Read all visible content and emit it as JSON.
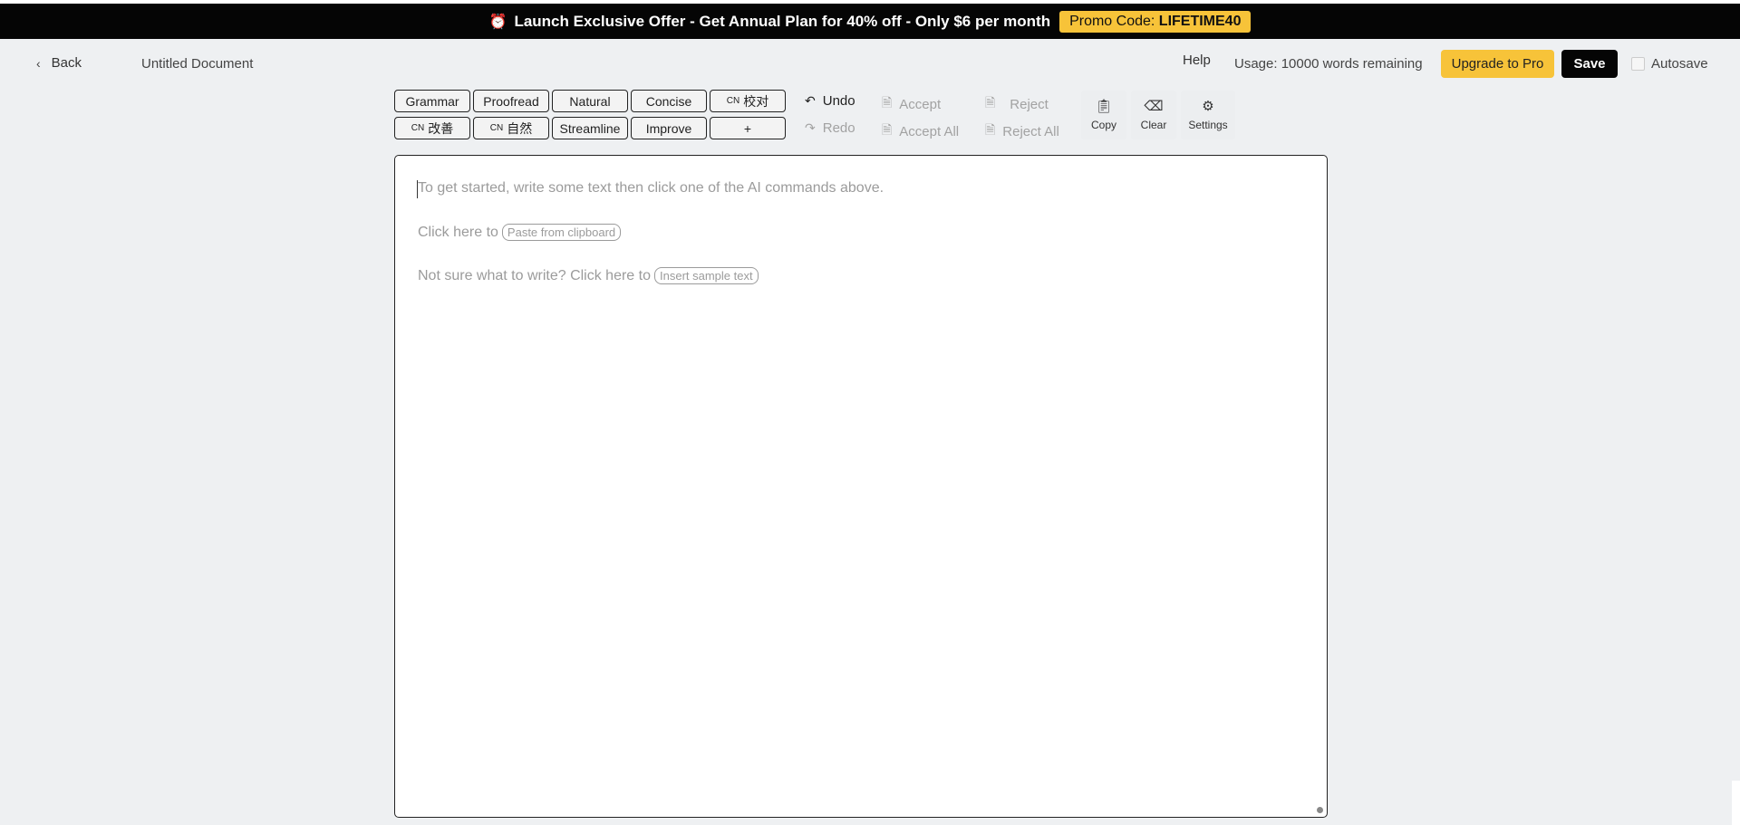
{
  "banner": {
    "icon": "alarm-clock-icon",
    "text": "Launch Exclusive Offer -   Get Annual Plan for 40% off - Only $6 per month",
    "promo_label": "Promo Code: ",
    "promo_code": "LIFETIME40"
  },
  "header": {
    "back_label": "Back",
    "doc_title": "Untitled Document",
    "help_label": "Help",
    "usage_text": "Usage: 10000 words remaining",
    "upgrade_label": "Upgrade to Pro",
    "save_label": "Save",
    "autosave_label": "Autosave"
  },
  "commands": {
    "row1": [
      {
        "label": "Grammar"
      },
      {
        "label": "Proofread"
      },
      {
        "label": "Natural"
      },
      {
        "label": "Concise"
      },
      {
        "prefix": "CN",
        "label": "校对"
      }
    ],
    "row2": [
      {
        "prefix": "CN",
        "label": "改善"
      },
      {
        "prefix": "CN",
        "label": "自然"
      },
      {
        "label": "Streamline"
      },
      {
        "label": "Improve"
      },
      {
        "label": "+"
      }
    ]
  },
  "actions": {
    "undo": "Undo",
    "redo": "Redo",
    "accept": "Accept",
    "accept_all": "Accept All",
    "reject": "Reject",
    "reject_all": "Reject All"
  },
  "tools": {
    "copy": "Copy",
    "clear": "Clear",
    "settings": "Settings"
  },
  "editor": {
    "placeholder": "To get started, write some text then click one of the AI commands above.",
    "paste_prompt": "Click here to",
    "paste_chip": "Paste from clipboard",
    "sample_prompt": "Not sure what to write? Click here to",
    "sample_chip": "Insert sample text"
  },
  "colors": {
    "banner_bg": "#050505",
    "accent_yellow": "#f7c339",
    "save_bg": "#050505",
    "page_bg": "#eef0f2"
  }
}
